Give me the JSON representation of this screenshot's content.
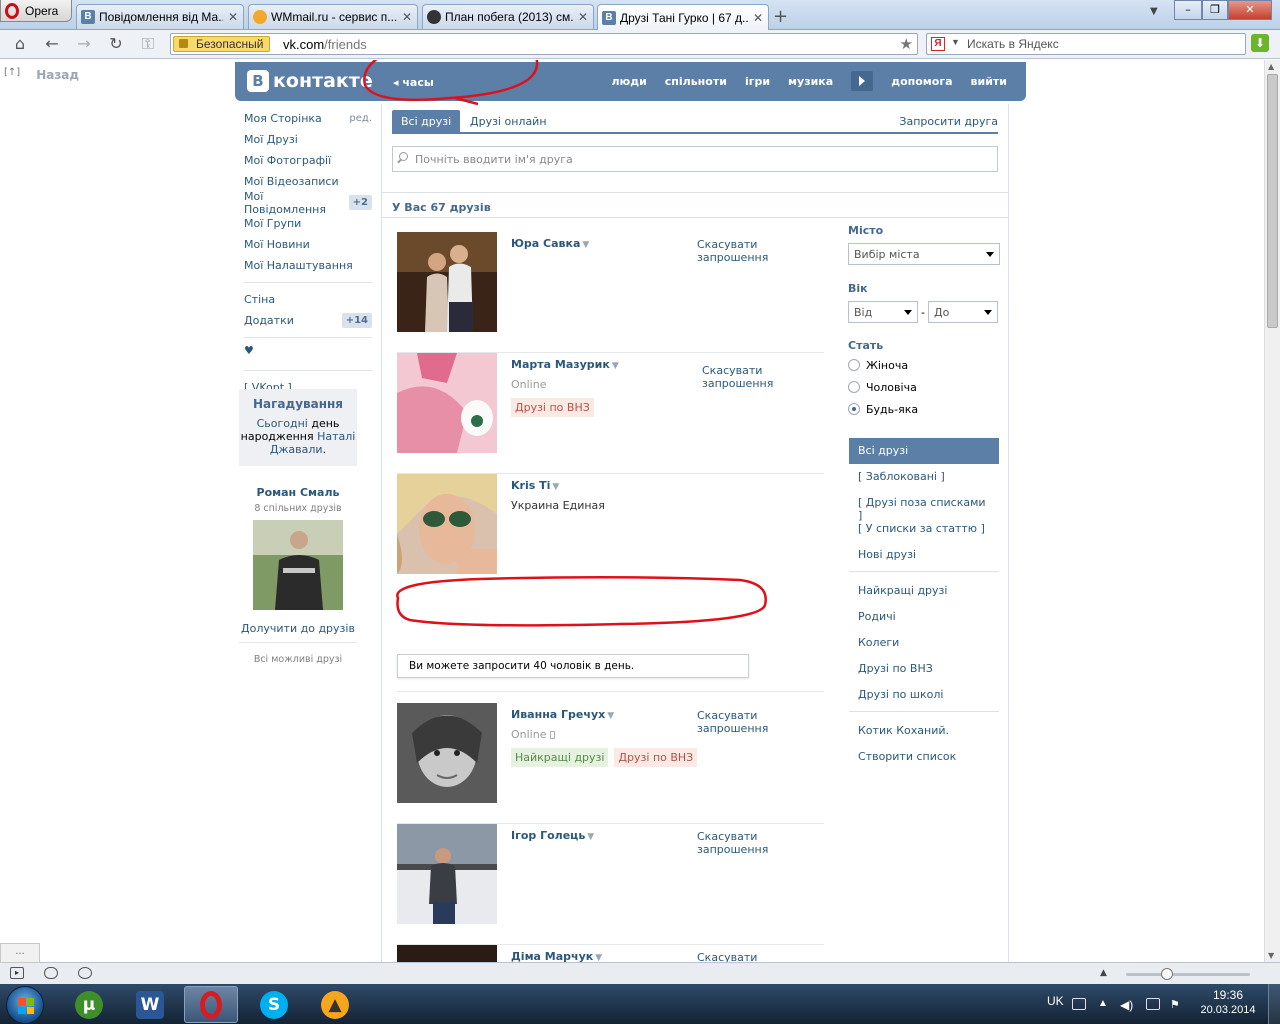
{
  "browser": {
    "menu_label": "Opera",
    "tabs": [
      {
        "title": "Повідомлення від Ма...",
        "icon": "vk-icon"
      },
      {
        "title": "WMmail.ru - сервис п...",
        "icon": "wmmail-icon"
      },
      {
        "title": "План побега (2013) см...",
        "icon": "face-icon"
      },
      {
        "title": "Друзі Тані Гурко | 67 д...",
        "icon": "vk-icon"
      }
    ],
    "security_label": "Безопасный",
    "url_host": "vk.com",
    "url_path": "/friends",
    "search_placeholder": "Искать в Яндекс",
    "back_link": "Назад",
    "back_up": "[↑]"
  },
  "vk": {
    "logo_letter": "В",
    "logo_text": "контакте",
    "music_now": "часы",
    "top_menu": [
      "люди",
      "спільноти",
      "ігри",
      "музика",
      "допомога",
      "вийти"
    ],
    "left_nav": [
      {
        "label": "Моя Сторінка",
        "extra": "ред."
      },
      {
        "label": "Мої Друзі"
      },
      {
        "label": "Мої Фотографії"
      },
      {
        "label": "Мої Відеозаписи"
      },
      {
        "label": "Мої Повідомлення",
        "badge": "+2"
      },
      {
        "label": "Мої Групи"
      },
      {
        "label": "Мої Новини"
      },
      {
        "label": "Мої Налаштування"
      }
    ],
    "left_nav2": [
      {
        "label": "Стіна"
      },
      {
        "label": "Додатки",
        "badge": "+14"
      }
    ],
    "heart": "♥",
    "vkopt": "[ VKopt ]",
    "reminder": {
      "title": "Нагадування",
      "today": "Сьогодні",
      "text1": " день",
      "text2": "народження ",
      "name": "Наталі Джавали",
      "dot": "."
    },
    "suggestion": {
      "name": "Роман Смаль",
      "common": "8 спільних друзів",
      "join": "Долучити до друзів",
      "all_possible": "Всі можливі друзі"
    },
    "friends_tabs": {
      "all": "Всі друзі",
      "online": "Друзі онлайн",
      "invite": "Запросити друга"
    },
    "search_placeholder": "Почніть вводити ім'я друга",
    "count_text": "У Вас 67 друзів",
    "friends": [
      {
        "name": "Юра Савка",
        "sub": "",
        "tags": [],
        "action": "Скасувати запрошення"
      },
      {
        "name": "Марта Мазурик",
        "sub": "Online",
        "tags": [
          {
            "label": "Друзі по ВНЗ",
            "kind": "red"
          }
        ],
        "action": "Скасувати запрошення"
      },
      {
        "name": "Kris Ti",
        "sub": "Украина Единая",
        "tags": [],
        "action": ""
      },
      {
        "name": "Иванна Гречух",
        "sub": "Online",
        "tags": [
          {
            "label": "Найкращі друзі",
            "kind": "green"
          },
          {
            "label": "Друзі по ВНЗ",
            "kind": "red"
          }
        ],
        "action": "Скасувати запрошення"
      },
      {
        "name": "Ігор Голець",
        "sub": "",
        "tags": [],
        "action": "Скасувати запрошення"
      },
      {
        "name": "Діма Марчук",
        "sub": "",
        "tags": [],
        "action": "Скасувати запрошення"
      }
    ],
    "invite_note": "Ви можете запросити 40 чоловік в день.",
    "filters": {
      "city_label": "Місто",
      "city_value": "Вибір міста",
      "age_label": "Вік",
      "age_from": "Від",
      "age_dash": "-",
      "age_to": "До",
      "sex_label": "Стать",
      "sex_options": [
        {
          "label": "Жіноча",
          "checked": false
        },
        {
          "label": "Чоловіча",
          "checked": false
        },
        {
          "label": "Будь-яка",
          "checked": true
        }
      ]
    },
    "lists": {
      "group1": [
        "Всі друзі",
        "[ Заблоковані ]",
        "[ Друзі поза списками ]",
        "[ У списки за статтю ]",
        "Нові друзі"
      ],
      "group2": [
        "Найкращі друзі",
        "Родичі",
        "Колеги",
        "Друзі по ВНЗ",
        "Друзі по школі"
      ],
      "group3": [
        "Котик Коханий.",
        "Створити список"
      ]
    }
  },
  "statusbar": {
    "dots": "..."
  },
  "taskbar": {
    "apps": [
      "utorrent",
      "word",
      "opera",
      "skype",
      "aimp"
    ],
    "lang": "UK",
    "time": "19:36",
    "date": "20.03.2014"
  },
  "colors": {
    "vk_blue": "#5b7fa6",
    "vk_link": "#2b587a",
    "annotation": "#e0101a"
  }
}
